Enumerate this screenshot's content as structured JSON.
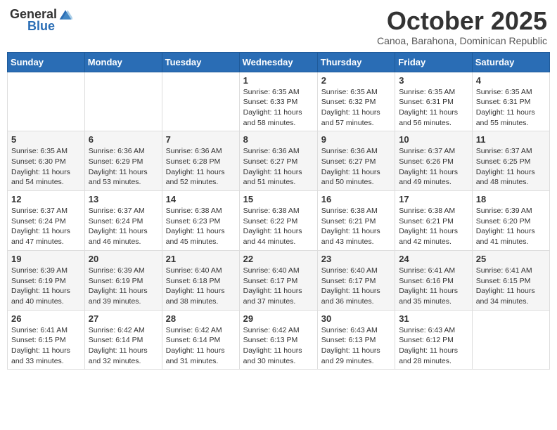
{
  "logo": {
    "general": "General",
    "blue": "Blue"
  },
  "header": {
    "month": "October 2025",
    "location": "Canoa, Barahona, Dominican Republic"
  },
  "days_of_week": [
    "Sunday",
    "Monday",
    "Tuesday",
    "Wednesday",
    "Thursday",
    "Friday",
    "Saturday"
  ],
  "weeks": [
    [
      {
        "day": "",
        "info": ""
      },
      {
        "day": "",
        "info": ""
      },
      {
        "day": "",
        "info": ""
      },
      {
        "day": "1",
        "sunrise": "Sunrise: 6:35 AM",
        "sunset": "Sunset: 6:33 PM",
        "daylight": "Daylight: 11 hours and 58 minutes."
      },
      {
        "day": "2",
        "sunrise": "Sunrise: 6:35 AM",
        "sunset": "Sunset: 6:32 PM",
        "daylight": "Daylight: 11 hours and 57 minutes."
      },
      {
        "day": "3",
        "sunrise": "Sunrise: 6:35 AM",
        "sunset": "Sunset: 6:31 PM",
        "daylight": "Daylight: 11 hours and 56 minutes."
      },
      {
        "day": "4",
        "sunrise": "Sunrise: 6:35 AM",
        "sunset": "Sunset: 6:31 PM",
        "daylight": "Daylight: 11 hours and 55 minutes."
      }
    ],
    [
      {
        "day": "5",
        "sunrise": "Sunrise: 6:35 AM",
        "sunset": "Sunset: 6:30 PM",
        "daylight": "Daylight: 11 hours and 54 minutes."
      },
      {
        "day": "6",
        "sunrise": "Sunrise: 6:36 AM",
        "sunset": "Sunset: 6:29 PM",
        "daylight": "Daylight: 11 hours and 53 minutes."
      },
      {
        "day": "7",
        "sunrise": "Sunrise: 6:36 AM",
        "sunset": "Sunset: 6:28 PM",
        "daylight": "Daylight: 11 hours and 52 minutes."
      },
      {
        "day": "8",
        "sunrise": "Sunrise: 6:36 AM",
        "sunset": "Sunset: 6:27 PM",
        "daylight": "Daylight: 11 hours and 51 minutes."
      },
      {
        "day": "9",
        "sunrise": "Sunrise: 6:36 AM",
        "sunset": "Sunset: 6:27 PM",
        "daylight": "Daylight: 11 hours and 50 minutes."
      },
      {
        "day": "10",
        "sunrise": "Sunrise: 6:37 AM",
        "sunset": "Sunset: 6:26 PM",
        "daylight": "Daylight: 11 hours and 49 minutes."
      },
      {
        "day": "11",
        "sunrise": "Sunrise: 6:37 AM",
        "sunset": "Sunset: 6:25 PM",
        "daylight": "Daylight: 11 hours and 48 minutes."
      }
    ],
    [
      {
        "day": "12",
        "sunrise": "Sunrise: 6:37 AM",
        "sunset": "Sunset: 6:24 PM",
        "daylight": "Daylight: 11 hours and 47 minutes."
      },
      {
        "day": "13",
        "sunrise": "Sunrise: 6:37 AM",
        "sunset": "Sunset: 6:24 PM",
        "daylight": "Daylight: 11 hours and 46 minutes."
      },
      {
        "day": "14",
        "sunrise": "Sunrise: 6:38 AM",
        "sunset": "Sunset: 6:23 PM",
        "daylight": "Daylight: 11 hours and 45 minutes."
      },
      {
        "day": "15",
        "sunrise": "Sunrise: 6:38 AM",
        "sunset": "Sunset: 6:22 PM",
        "daylight": "Daylight: 11 hours and 44 minutes."
      },
      {
        "day": "16",
        "sunrise": "Sunrise: 6:38 AM",
        "sunset": "Sunset: 6:21 PM",
        "daylight": "Daylight: 11 hours and 43 minutes."
      },
      {
        "day": "17",
        "sunrise": "Sunrise: 6:38 AM",
        "sunset": "Sunset: 6:21 PM",
        "daylight": "Daylight: 11 hours and 42 minutes."
      },
      {
        "day": "18",
        "sunrise": "Sunrise: 6:39 AM",
        "sunset": "Sunset: 6:20 PM",
        "daylight": "Daylight: 11 hours and 41 minutes."
      }
    ],
    [
      {
        "day": "19",
        "sunrise": "Sunrise: 6:39 AM",
        "sunset": "Sunset: 6:19 PM",
        "daylight": "Daylight: 11 hours and 40 minutes."
      },
      {
        "day": "20",
        "sunrise": "Sunrise: 6:39 AM",
        "sunset": "Sunset: 6:19 PM",
        "daylight": "Daylight: 11 hours and 39 minutes."
      },
      {
        "day": "21",
        "sunrise": "Sunrise: 6:40 AM",
        "sunset": "Sunset: 6:18 PM",
        "daylight": "Daylight: 11 hours and 38 minutes."
      },
      {
        "day": "22",
        "sunrise": "Sunrise: 6:40 AM",
        "sunset": "Sunset: 6:17 PM",
        "daylight": "Daylight: 11 hours and 37 minutes."
      },
      {
        "day": "23",
        "sunrise": "Sunrise: 6:40 AM",
        "sunset": "Sunset: 6:17 PM",
        "daylight": "Daylight: 11 hours and 36 minutes."
      },
      {
        "day": "24",
        "sunrise": "Sunrise: 6:41 AM",
        "sunset": "Sunset: 6:16 PM",
        "daylight": "Daylight: 11 hours and 35 minutes."
      },
      {
        "day": "25",
        "sunrise": "Sunrise: 6:41 AM",
        "sunset": "Sunset: 6:15 PM",
        "daylight": "Daylight: 11 hours and 34 minutes."
      }
    ],
    [
      {
        "day": "26",
        "sunrise": "Sunrise: 6:41 AM",
        "sunset": "Sunset: 6:15 PM",
        "daylight": "Daylight: 11 hours and 33 minutes."
      },
      {
        "day": "27",
        "sunrise": "Sunrise: 6:42 AM",
        "sunset": "Sunset: 6:14 PM",
        "daylight": "Daylight: 11 hours and 32 minutes."
      },
      {
        "day": "28",
        "sunrise": "Sunrise: 6:42 AM",
        "sunset": "Sunset: 6:14 PM",
        "daylight": "Daylight: 11 hours and 31 minutes."
      },
      {
        "day": "29",
        "sunrise": "Sunrise: 6:42 AM",
        "sunset": "Sunset: 6:13 PM",
        "daylight": "Daylight: 11 hours and 30 minutes."
      },
      {
        "day": "30",
        "sunrise": "Sunrise: 6:43 AM",
        "sunset": "Sunset: 6:13 PM",
        "daylight": "Daylight: 11 hours and 29 minutes."
      },
      {
        "day": "31",
        "sunrise": "Sunrise: 6:43 AM",
        "sunset": "Sunset: 6:12 PM",
        "daylight": "Daylight: 11 hours and 28 minutes."
      },
      {
        "day": "",
        "info": ""
      }
    ]
  ]
}
